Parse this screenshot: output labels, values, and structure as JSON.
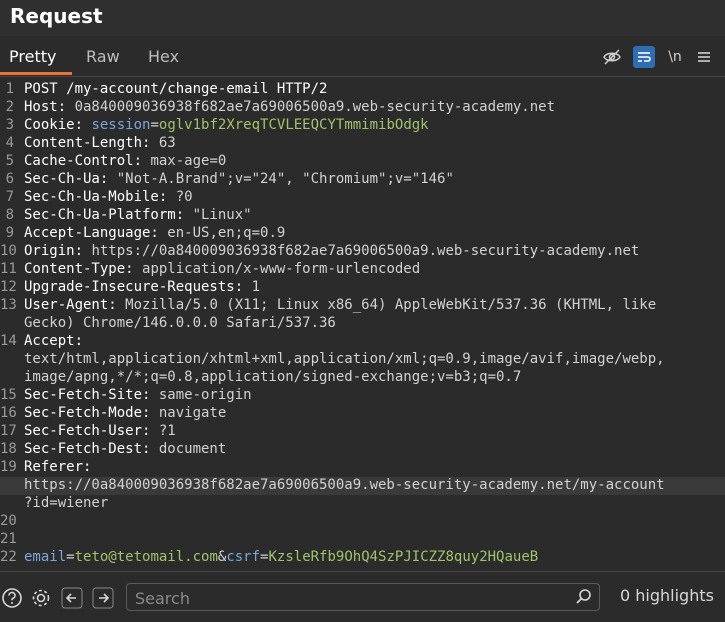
{
  "window": {
    "title": "Request"
  },
  "tabs": [
    {
      "label": "Pretty",
      "active": true
    },
    {
      "label": "Raw"
    },
    {
      "label": "Hex"
    }
  ],
  "toolbar": {
    "newline_label": "\\n"
  },
  "request_lines": [
    {
      "n": "1",
      "key": "POST /my-account/change-email HTTP/2",
      "val": ""
    },
    {
      "n": "2",
      "key": "Host: ",
      "val": "0a840009036938f682ae7a69006500a9.web-security-academy.net"
    },
    {
      "n": "3",
      "key": "Cookie: ",
      "ckey": "session",
      "eq": "=",
      "cval": "oglv1bf2XreqTCVLEEQCYTmmimibOdgk"
    },
    {
      "n": "4",
      "key": "Content-Length: ",
      "val": "63"
    },
    {
      "n": "5",
      "key": "Cache-Control: ",
      "val": "max-age=0"
    },
    {
      "n": "6",
      "key": "Sec-Ch-Ua: ",
      "val": "\"Not-A.Brand\";v=\"24\", \"Chromium\";v=\"146\""
    },
    {
      "n": "7",
      "key": "Sec-Ch-Ua-Mobile: ",
      "val": "?0"
    },
    {
      "n": "8",
      "key": "Sec-Ch-Ua-Platform: ",
      "val": "\"Linux\""
    },
    {
      "n": "9",
      "key": "Accept-Language: ",
      "val": "en-US,en;q=0.9"
    },
    {
      "n": "10",
      "key": "Origin: ",
      "val": "https://0a840009036938f682ae7a69006500a9.web-security-academy.net"
    },
    {
      "n": "11",
      "key": "Content-Type: ",
      "val": "application/x-www-form-urlencoded"
    },
    {
      "n": "12",
      "key": "Upgrade-Insecure-Requests: ",
      "val": "1"
    },
    {
      "n": "13",
      "key": "User-Agent: ",
      "val": "Mozilla/5.0 (X11; Linux x86_64) AppleWebKit/537.36 (KHTML, like"
    },
    {
      "n": "",
      "key": "",
      "val": "Gecko) Chrome/146.0.0.0 Safari/537.36"
    },
    {
      "n": "14",
      "key": "Accept:",
      "val": ""
    },
    {
      "n": "",
      "key": "",
      "val": "text/html,application/xhtml+xml,application/xml;q=0.9,image/avif,image/webp,"
    },
    {
      "n": "",
      "key": "",
      "val": "image/apng,*/*;q=0.8,application/signed-exchange;v=b3;q=0.7"
    },
    {
      "n": "15",
      "key": "Sec-Fetch-Site: ",
      "val": "same-origin"
    },
    {
      "n": "16",
      "key": "Sec-Fetch-Mode: ",
      "val": "navigate"
    },
    {
      "n": "17",
      "key": "Sec-Fetch-User: ",
      "val": "?1"
    },
    {
      "n": "18",
      "key": "Sec-Fetch-Dest: ",
      "val": "document"
    },
    {
      "n": "19",
      "key": "Referer:",
      "val": ""
    },
    {
      "n": "",
      "key": "",
      "val": "https://0a840009036938f682ae7a69006500a9.web-security-academy.net/my-account",
      "hl": true
    },
    {
      "n": "",
      "key": "",
      "val": "?id=wiener"
    },
    {
      "n": "20",
      "key": "",
      "val": ""
    },
    {
      "n": "21",
      "key": "",
      "val": ""
    },
    {
      "n": "22",
      "body": true,
      "k1": "email",
      "v1": "teto@tetomail.com",
      "amp": "&",
      "k2": "csrf",
      "v2": "KzsleRfb9OhQ4SzPJICZZ8quy2HQaueB"
    }
  ],
  "search": {
    "placeholder": "Search",
    "value": ""
  },
  "status": {
    "highlights": "0 highlights"
  },
  "colors": {
    "accent": "#e8743b",
    "selected_tool": "#2f6db3",
    "cookie_value": "#a0c46a",
    "cookie_key": "#7aa6da"
  }
}
